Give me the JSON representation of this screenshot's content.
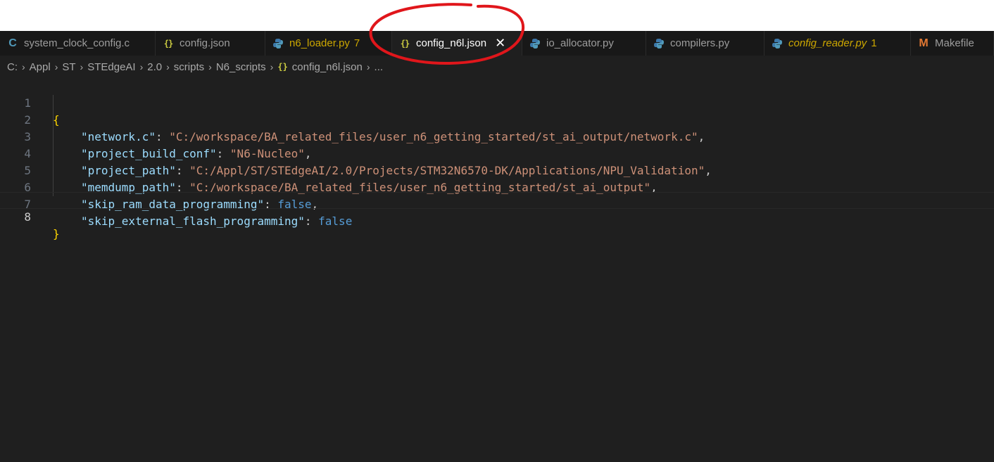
{
  "tabs": [
    {
      "label": "system_clock_config.c",
      "icon": "c-icon"
    },
    {
      "label": "config.json",
      "icon": "json-icon"
    },
    {
      "label": "n6_loader.py",
      "icon": "python-icon",
      "badge": "7"
    },
    {
      "label": "config_n6l.json",
      "icon": "json-icon",
      "active": true,
      "close": "✕"
    },
    {
      "label": "io_allocator.py",
      "icon": "python-icon"
    },
    {
      "label": "compilers.py",
      "icon": "python-icon"
    },
    {
      "label": "config_reader.py",
      "icon": "python-icon",
      "badge": "1"
    },
    {
      "label": "Makefile",
      "icon": "makefile-icon"
    }
  ],
  "breadcrumb": [
    "C:",
    "Appl",
    "ST",
    "STEdgeAI",
    "2.0",
    "scripts",
    "N6_scripts",
    "config_n6l.json",
    "..."
  ],
  "editor": {
    "line_numbers": [
      "1",
      "2",
      "3",
      "4",
      "5",
      "6",
      "7",
      "8"
    ],
    "active_line": "8",
    "open_brace": "{",
    "close_brace": "}",
    "entries": [
      {
        "key": "\"network.c\"",
        "value": "\"C:/workspace/BA_related_files/user_n6_getting_started/st_ai_output/network.c\"",
        "trail": ","
      },
      {
        "key": "\"project_build_conf\"",
        "value": "\"N6-Nucleo\"",
        "trail": ","
      },
      {
        "key": "\"project_path\"",
        "value": "\"C:/Appl/ST/STEdgeAI/2.0/Projects/STM32N6570-DK/Applications/NPU_Validation\"",
        "trail": ","
      },
      {
        "key": "\"memdump_path\"",
        "value": "\"C:/workspace/BA_related_files/user_n6_getting_started/st_ai_output\"",
        "trail": ","
      },
      {
        "key": "\"skip_ram_data_programming\"",
        "value": "false",
        "trail": ","
      },
      {
        "key": "\"skip_external_flash_programming\"",
        "value": "false",
        "trail": ""
      }
    ],
    "colon": ": "
  },
  "colors": {
    "annotation": "#e0161b",
    "string": "#ce9178",
    "key": "#9cdcfe",
    "boolean": "#569cd6",
    "brace": "#ffd700"
  }
}
